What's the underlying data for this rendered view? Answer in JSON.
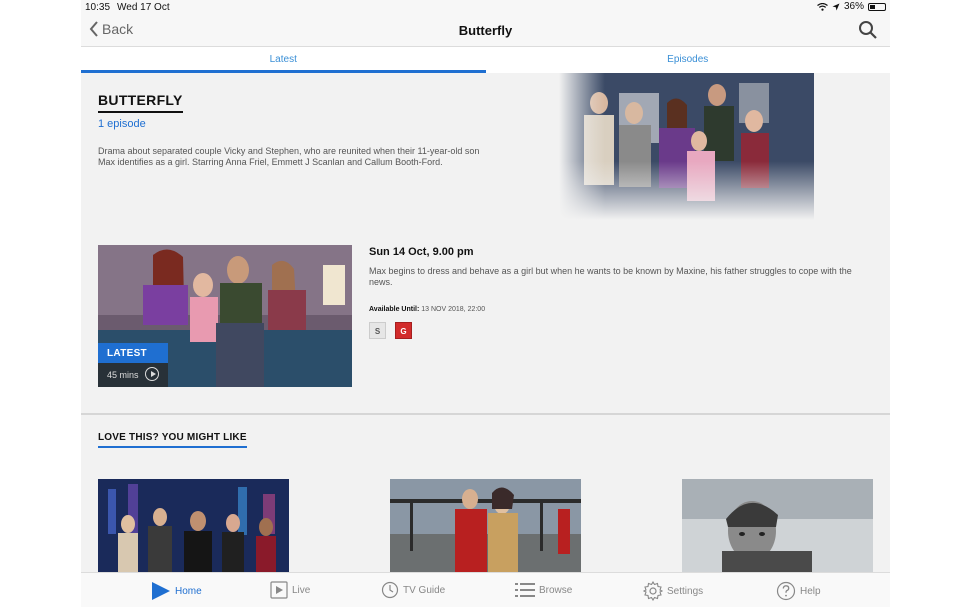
{
  "status_bar": {
    "time": "10:35",
    "date": "Wed 17 Oct",
    "battery": "36%"
  },
  "nav": {
    "back_label": "Back",
    "title": "Butterfly"
  },
  "tabs": [
    {
      "label": "Latest",
      "active": true
    },
    {
      "label": "Episodes",
      "active": false
    }
  ],
  "show": {
    "title": "BUTTERFLY",
    "episode_count": "1 episode",
    "description": "Drama about separated couple Vicky and Stephen, who are reunited when their 11-year-old son Max identifies as a girl. Starring Anna Friel, Emmett J Scanlan and Callum Booth-Ford."
  },
  "episode": {
    "badge": "LATEST",
    "duration": "45 mins",
    "datetime": "Sun 14 Oct, 9.00 pm",
    "description": "Max begins to dress and behave as a girl but when he wants to be known by Maxine, his father struggles to cope with the news.",
    "available_label": "Available Until:",
    "available_value": "13 NOV 2018, 22:00",
    "rating_s": "S",
    "rating_g": "G"
  },
  "recommendations": {
    "title": "LOVE THIS? YOU MIGHT LIKE"
  },
  "tab_bar": [
    {
      "label": "Home",
      "icon": "home-play-icon",
      "active": true
    },
    {
      "label": "Live",
      "icon": "live-play-icon",
      "active": false
    },
    {
      "label": "TV Guide",
      "icon": "clock-icon",
      "active": false
    },
    {
      "label": "Browse",
      "icon": "list-icon",
      "active": false
    },
    {
      "label": "Settings",
      "icon": "gear-icon",
      "active": false
    },
    {
      "label": "Help",
      "icon": "help-icon",
      "active": false
    }
  ],
  "colors": {
    "accent": "#1f6fd1",
    "rating_g": "#d22b2b"
  }
}
